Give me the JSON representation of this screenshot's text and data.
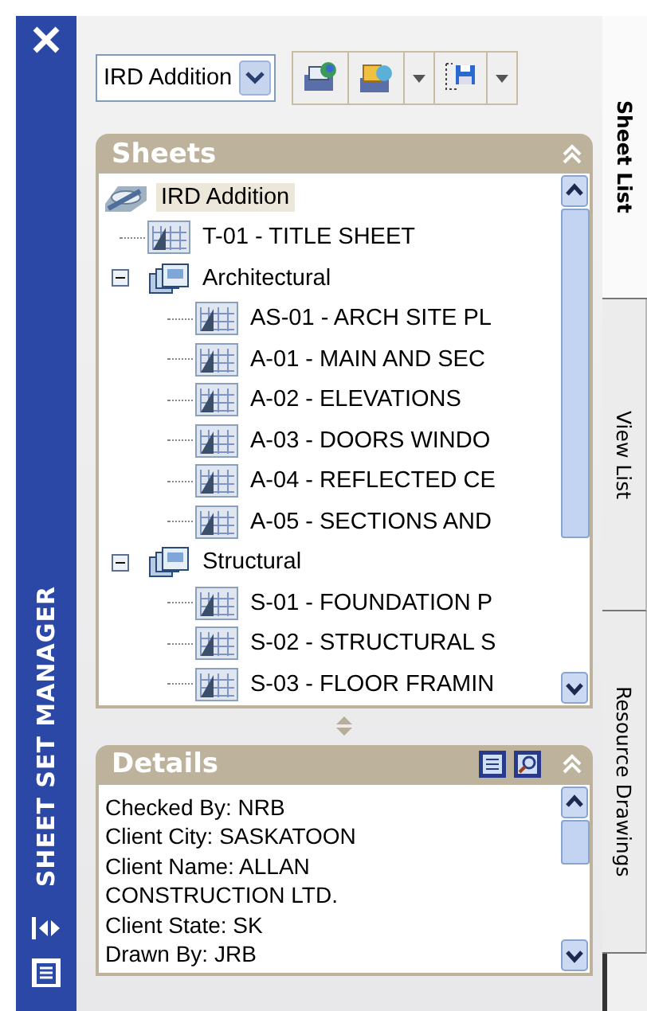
{
  "sidebar": {
    "title": "SHEET SET MANAGER"
  },
  "toolbar": {
    "sheet_set_dropdown": {
      "value": "IRD Addition"
    }
  },
  "sheets_panel": {
    "title": "Sheets",
    "tree": [
      {
        "kind": "sheet_set",
        "label": "IRD Addition",
        "selected": true,
        "children": [
          {
            "kind": "sheet",
            "label": "T-01 - TITLE SHEET",
            "selected": false
          },
          {
            "kind": "subset",
            "label": "Architectural",
            "selected": false,
            "expanded": true,
            "children": [
              {
                "kind": "sheet",
                "label": "AS-01 - ARCH SITE PL",
                "selected": false
              },
              {
                "kind": "sheet",
                "label": "A-01 - MAIN AND SEC",
                "selected": false
              },
              {
                "kind": "sheet",
                "label": "A-02 - ELEVATIONS",
                "selected": false
              },
              {
                "kind": "sheet",
                "label": "A-03 - DOORS WINDO",
                "selected": false
              },
              {
                "kind": "sheet",
                "label": "A-04 - REFLECTED CE",
                "selected": false
              },
              {
                "kind": "sheet",
                "label": "A-05 - SECTIONS AND",
                "selected": false
              }
            ]
          },
          {
            "kind": "subset",
            "label": "Structural",
            "selected": false,
            "expanded": true,
            "children": [
              {
                "kind": "sheet",
                "label": "S-01 - FOUNDATION P",
                "selected": false
              },
              {
                "kind": "sheet",
                "label": "S-02 - STRUCTURAL S",
                "selected": false
              },
              {
                "kind": "sheet",
                "label": "S-03 - FLOOR FRAMIN",
                "selected": false
              }
            ]
          }
        ]
      }
    ]
  },
  "details_panel": {
    "title": "Details",
    "lines": [
      "Checked By: NRB",
      "Client City: SASKATOON",
      "Client Name: ALLAN",
      "CONSTRUCTION LTD.",
      "Client State: SK",
      "Drawn By: JRB"
    ]
  },
  "tabs": [
    {
      "label": "Sheet List",
      "selected": true
    },
    {
      "label": "View List",
      "selected": false
    },
    {
      "label": "Resource Drawings",
      "selected": false
    }
  ]
}
